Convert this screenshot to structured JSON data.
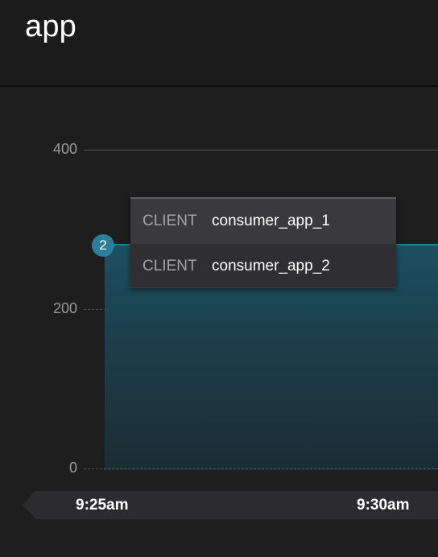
{
  "header": {
    "title": "app"
  },
  "chart_data": {
    "type": "area",
    "yaxis": {
      "ticks": [
        "400",
        "200",
        "0"
      ],
      "ylim": [
        0,
        400
      ]
    },
    "xaxis": {
      "ticks": [
        "9:25am",
        "9:30am"
      ]
    },
    "series": [
      {
        "values": [
          280,
          280
        ]
      }
    ],
    "grid": true
  },
  "marker": {
    "label": "2"
  },
  "tooltip": {
    "rows": [
      {
        "key": "CLIENT",
        "value": "consumer_app_1"
      },
      {
        "key": "CLIENT",
        "value": "consumer_app_2"
      }
    ]
  },
  "colors": {
    "area_top": "#2e7a93",
    "marker": "#2b7f9b",
    "background": "#1b1b1c"
  }
}
